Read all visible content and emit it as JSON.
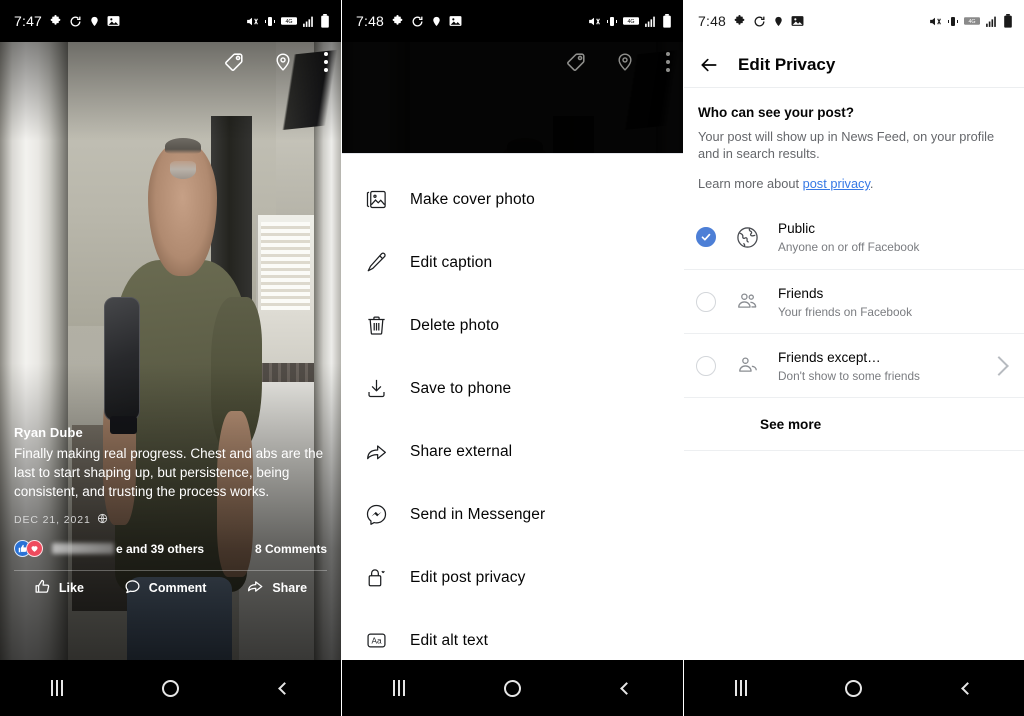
{
  "panels": {
    "photo_view": {
      "status": {
        "time": "7:47",
        "icons": [
          "puzzle-icon",
          "sync-icon",
          "location-icon",
          "image-icon",
          "mute-icon",
          "vibrate-icon",
          "4g-icon",
          "signal-icon",
          "battery-icon"
        ]
      },
      "photo_actions": {
        "tag": "tag-icon",
        "location": "location-pin-icon",
        "more": "more-options-icon"
      },
      "post": {
        "author": "Ryan Dube",
        "caption": "Finally making real progress. Chest and abs are the last to start shaping up, but persistence, being consistent, and trusting the process works.",
        "date": "DEC 21, 2021",
        "audience_icon": "globe-icon",
        "reaction_names": "e and 39 others",
        "comments": "8 Comments",
        "actions": [
          {
            "label": "Like",
            "icon": "thumbs-up-icon"
          },
          {
            "label": "Comment",
            "icon": "comment-bubble-icon"
          },
          {
            "label": "Share",
            "icon": "share-arrow-icon"
          }
        ]
      }
    },
    "menu_sheet": {
      "status": {
        "time": "7:48"
      },
      "items": [
        {
          "label": "Make cover photo",
          "icon": "photo-frame-icon"
        },
        {
          "label": "Edit caption",
          "icon": "pencil-icon"
        },
        {
          "label": "Delete photo",
          "icon": "trash-icon"
        },
        {
          "label": "Save to phone",
          "icon": "download-icon"
        },
        {
          "label": "Share external",
          "icon": "share-arrow-icon"
        },
        {
          "label": "Send in Messenger",
          "icon": "messenger-icon"
        },
        {
          "label": "Edit post privacy",
          "icon": "lock-icon"
        },
        {
          "label": "Edit alt text",
          "icon": "alt-text-icon"
        }
      ]
    },
    "edit_privacy": {
      "status": {
        "time": "7:48"
      },
      "back_icon": "back-arrow-icon",
      "title": "Edit Privacy",
      "question": "Who can see your post?",
      "description": "Your post will show up in News Feed, on your profile and in search results.",
      "learn_prefix": "Learn more about ",
      "learn_link": "post privacy",
      "learn_suffix": ".",
      "options": [
        {
          "title": "Public",
          "desc": "Anyone on or off Facebook",
          "icon": "globe-icon",
          "selected": true,
          "chevron": false
        },
        {
          "title": "Friends",
          "desc": "Your friends on Facebook",
          "icon": "two-people-icon",
          "selected": false,
          "chevron": false
        },
        {
          "title": "Friends except…",
          "desc": "Don't show to some friends",
          "icon": "person-minus-icon",
          "selected": false,
          "chevron": true
        }
      ],
      "see_more": "See more"
    }
  },
  "navbar": {
    "recents": "recents-icon",
    "home": "home-icon",
    "back": "back-icon"
  },
  "colors": {
    "accent": "#4d7fd6",
    "link": "#3578e5",
    "text": "#050505",
    "muted": "#65676b",
    "like": "#2a72d6",
    "love": "#ef4b5e"
  }
}
